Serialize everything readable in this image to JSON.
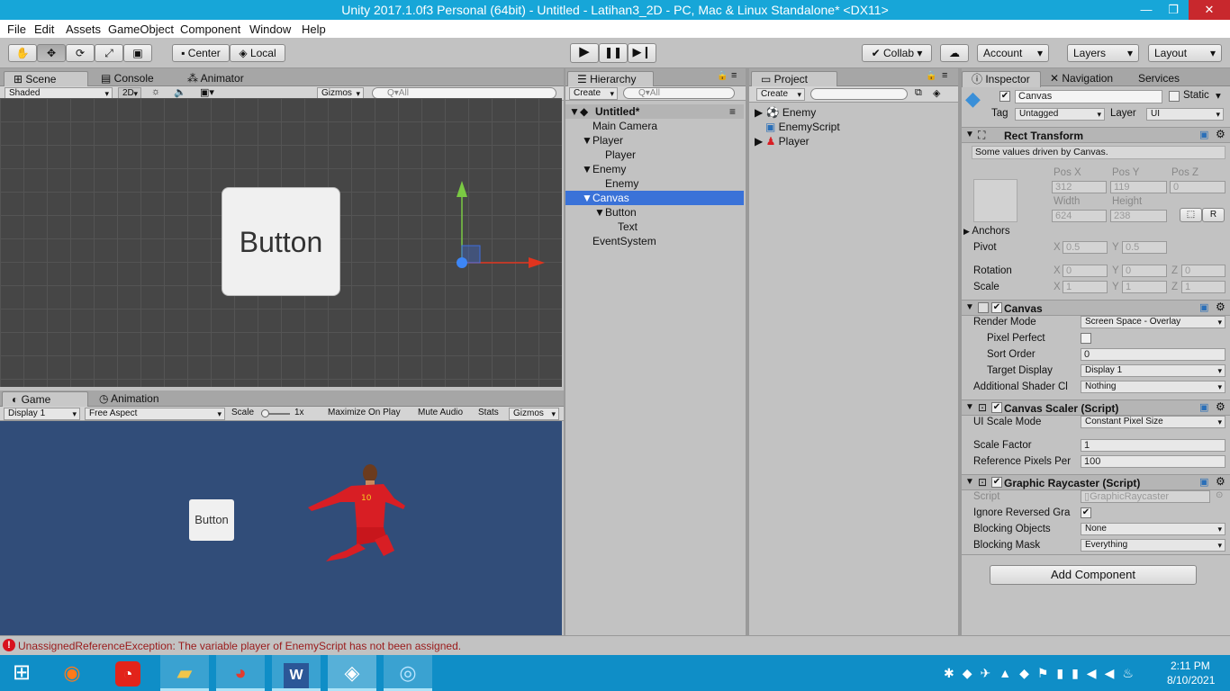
{
  "window": {
    "title": "Unity 2017.1.0f3 Personal (64bit) - Untitled - Latihan3_2D - PC, Mac & Linux Standalone* <DX11>",
    "min": "—",
    "max": "❐",
    "close": "✕"
  },
  "menu": [
    "File",
    "Edit",
    "Assets",
    "GameObject",
    "Component",
    "Window",
    "Help"
  ],
  "toolbar": {
    "center": "Center",
    "local": "Local",
    "collab": "Collab",
    "account": "Account",
    "layers": "Layers",
    "layout": "Layout"
  },
  "scene": {
    "tabs": [
      "Scene",
      "Console",
      "Animator"
    ],
    "shading": "Shaded",
    "mode2d": "2D",
    "gizmos": "Gizmos",
    "search": "Q▾All",
    "button_text": "Button"
  },
  "game": {
    "tabs": [
      "Game",
      "Animation"
    ],
    "display": "Display 1",
    "aspect": "Free Aspect",
    "scale_label": "Scale",
    "scale_value": "1x",
    "maximize": "Maximize On Play",
    "mute": "Mute Audio",
    "stats": "Stats",
    "gizmos": "Gizmos",
    "button_text": "Button"
  },
  "hierarchy": {
    "tab": "Hierarchy",
    "create": "Create",
    "search": "Q▾All",
    "scene": "Untitled*",
    "items": [
      {
        "label": "Main Camera"
      },
      {
        "label": "Player"
      },
      {
        "label": "Player"
      },
      {
        "label": "Enemy"
      },
      {
        "label": "Enemy"
      },
      {
        "label": "Canvas"
      },
      {
        "label": "Button"
      },
      {
        "label": "Text"
      },
      {
        "label": "EventSystem"
      }
    ]
  },
  "project": {
    "tab": "Project",
    "create": "Create",
    "items": [
      "Enemy",
      "EnemyScript",
      "Player"
    ]
  },
  "inspector": {
    "tabs": [
      "Inspector",
      "Navigation",
      "Services"
    ],
    "name": "Canvas",
    "static": "Static",
    "tag_label": "Tag",
    "tag": "Untagged",
    "layer_label": "Layer",
    "layer": "UI",
    "rect": {
      "title": "Rect Transform",
      "note": "Some values driven by Canvas.",
      "posx_l": "Pos X",
      "posy_l": "Pos Y",
      "posz_l": "Pos Z",
      "posx": "312",
      "posy": "119",
      "posz": "0",
      "w_l": "Width",
      "h_l": "Height",
      "w": "624",
      "h": "238",
      "r": "R",
      "anchors": "Anchors",
      "pivot": "Pivot",
      "px": "0.5",
      "py": "0.5",
      "rotation": "Rotation",
      "rx": "0",
      "ry": "0",
      "rz": "0",
      "scale": "Scale",
      "sx": "1",
      "sy": "1",
      "sz": "1",
      "X": "X",
      "Y": "Y",
      "Z": "Z"
    },
    "canvas": {
      "title": "Canvas",
      "render_mode_l": "Render Mode",
      "render_mode": "Screen Space - Overlay",
      "pixel_perfect": "Pixel Perfect",
      "sort_order_l": "Sort Order",
      "sort_order": "0",
      "target_display_l": "Target Display",
      "target_display": "Display 1",
      "shader_l": "Additional Shader Cl",
      "shader": "Nothing"
    },
    "scaler": {
      "title": "Canvas Scaler (Script)",
      "mode_l": "UI Scale Mode",
      "mode": "Constant Pixel Size",
      "factor_l": "Scale Factor",
      "factor": "1",
      "ref_l": "Reference Pixels Per",
      "ref": "100"
    },
    "raycaster": {
      "title": "Graphic Raycaster (Script)",
      "script_l": "Script",
      "script": "GraphicRaycaster",
      "ignore_l": "Ignore Reversed Gra",
      "blocking_obj_l": "Blocking Objects",
      "blocking_obj": "None",
      "mask_l": "Blocking Mask",
      "mask": "Everything"
    },
    "add_component": "Add Component"
  },
  "status": {
    "error": "UnassignedReferenceException: The variable player of EnemyScript has not been assigned."
  },
  "taskbar": {
    "time": "2:11 PM",
    "date": "8/10/2021"
  }
}
